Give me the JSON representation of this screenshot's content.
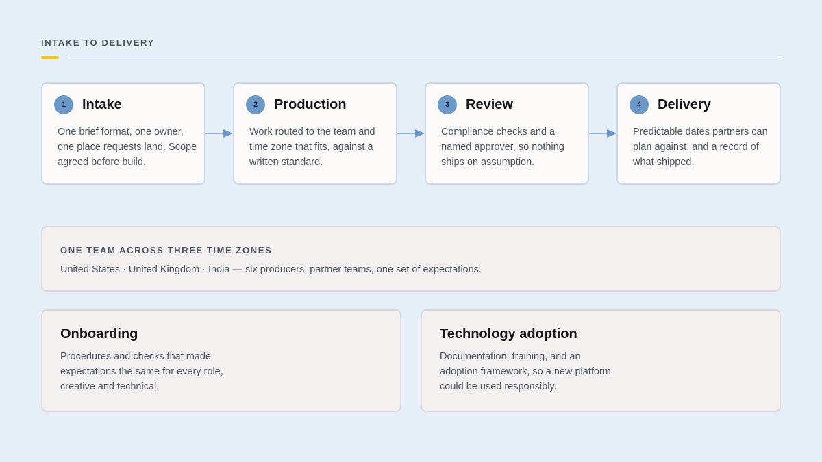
{
  "header": {
    "eyebrow": "INTAKE TO DELIVERY",
    "accent_color": "#f5c518"
  },
  "steps": [
    {
      "number": "1",
      "title": "Intake",
      "description": "One brief format, one owner, one place requests land. Scope agreed before build."
    },
    {
      "number": "2",
      "title": "Production",
      "description": "Work routed to the team and time zone that fits, against a written standard."
    },
    {
      "number": "3",
      "title": "Review",
      "description": "Compliance checks and a named approver, so nothing ships on assumption."
    },
    {
      "number": "4",
      "title": "Delivery",
      "description": "Predictable dates partners can plan against, and a record of what shipped."
    }
  ],
  "team": {
    "label": "ONE TEAM ACROSS THREE TIME ZONES",
    "text": "United States · United Kingdom · India — six producers, partner teams, one set of expectations."
  },
  "cards": [
    {
      "title": "Onboarding",
      "description": "Procedures and checks that made expectations the same for every role, creative and technical."
    },
    {
      "title": "Technology adoption",
      "description": "Documentation, training, and an adoption framework, so a new platform could be used responsibly."
    }
  ],
  "colors": {
    "background": "#e6eef8",
    "step_badge": "#6a98c8",
    "arrow": "#6a98c8"
  }
}
